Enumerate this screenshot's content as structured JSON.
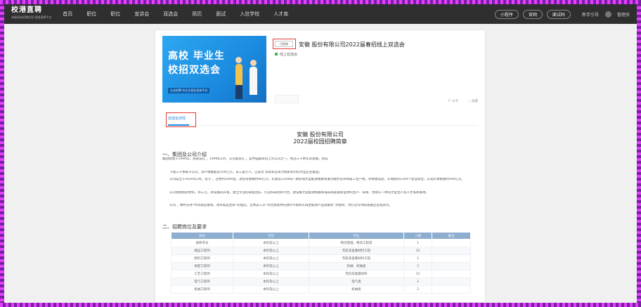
{
  "header": {
    "logo": "校港直聘",
    "logo_sub": "海量高校招聘信息 权威直聘平台",
    "nav": [
      "首页",
      "职位",
      "职位",
      "宣讲会",
      "双选会",
      "简历",
      "面试",
      "入驻学校",
      "人才库"
    ],
    "pills": [
      "小程序",
      "官网",
      "面试码"
    ],
    "user_link": "新手引导",
    "user_name": "管理员"
  },
  "event": {
    "banner_line1": "高校 毕业生",
    "banner_line2": "校招双选会",
    "banner_tagline": "企业招聘 毕业生就业双选平台",
    "status_tag": "已结束",
    "title": "安徽 股份有限公司2022届春招线上双选会",
    "subtag": "线上双选会",
    "share": "分享",
    "collect": "收藏"
  },
  "tabs": {
    "active": "双选会详情"
  },
  "doc": {
    "company": "安徽 股份有限公司",
    "subtitle": "2022届校园招聘简章",
    "section1": "一、集团及公司介绍",
    "p1": "集团始建于1996年，总部设在 ，1999年2月、公司股票在 ，是中国最早的上市公司之一。经过三十余年的发展，目前",
    "p2": "下辖三十余家子公司，资产规模超过100亿元，员工逾万人，已成为 等具有竞争力和影响力的大型企业集团。",
    "p3": "公司成立于2020年2月，位于 ，占地约2000亩，总投资规模约80亿元，年建设1200吨一期多线大型能源储备和重点服务化项目加工生产线，项目建成后，年增加约2300个就业岗位，实现年销售额约500亿元。",
    "p4": "公司将围绕新材料、新工艺、新设备的开发，建立专业的研发团队，打造科研创新平台，建设集大型能源储备和低碳高质量新型材料生产、研发、营销于一体的大型生产及人才培养基地。",
    "p5": "公司 ，始终坚持“时间就是金钱，效率就是生命”的理念，全体员工以“为社会提供先进的节能和可再生能源产品及服务”为使命，为打造可持续发展企业而努力。",
    "section2": "二、招聘岗位及要求",
    "table": {
      "headers": [
        "岗位",
        "学历",
        "专业",
        "人数",
        "备注"
      ],
      "rows": [
        [
          "采购专员",
          "本科及以上",
          "物流管理、物流工程等",
          "1",
          ""
        ],
        [
          "储运工程师",
          "本科及以上",
          "无机非金属材料工程",
          "10",
          ""
        ],
        [
          "原料工程师",
          "本科及以上",
          "无机非金属材料工程",
          "2",
          ""
        ],
        [
          "采配工程师",
          "本科及以上",
          "机械、机械类",
          "3",
          ""
        ],
        [
          "工艺工程师",
          "本科及以上",
          "无机非金属材料",
          "12",
          ""
        ],
        [
          "电气工程师",
          "本科及以上",
          "电气类",
          "2",
          ""
        ],
        [
          "机械工程师",
          "本科及以上",
          "机械类",
          "2",
          ""
        ]
      ]
    }
  },
  "colors": {
    "topbar": "#2f2f2f",
    "accent": "#1e88e5",
    "highlight_box": "#e53935",
    "frame": "#e040fb",
    "banner": "#1b8be0",
    "table_header": "#8eaed0"
  }
}
